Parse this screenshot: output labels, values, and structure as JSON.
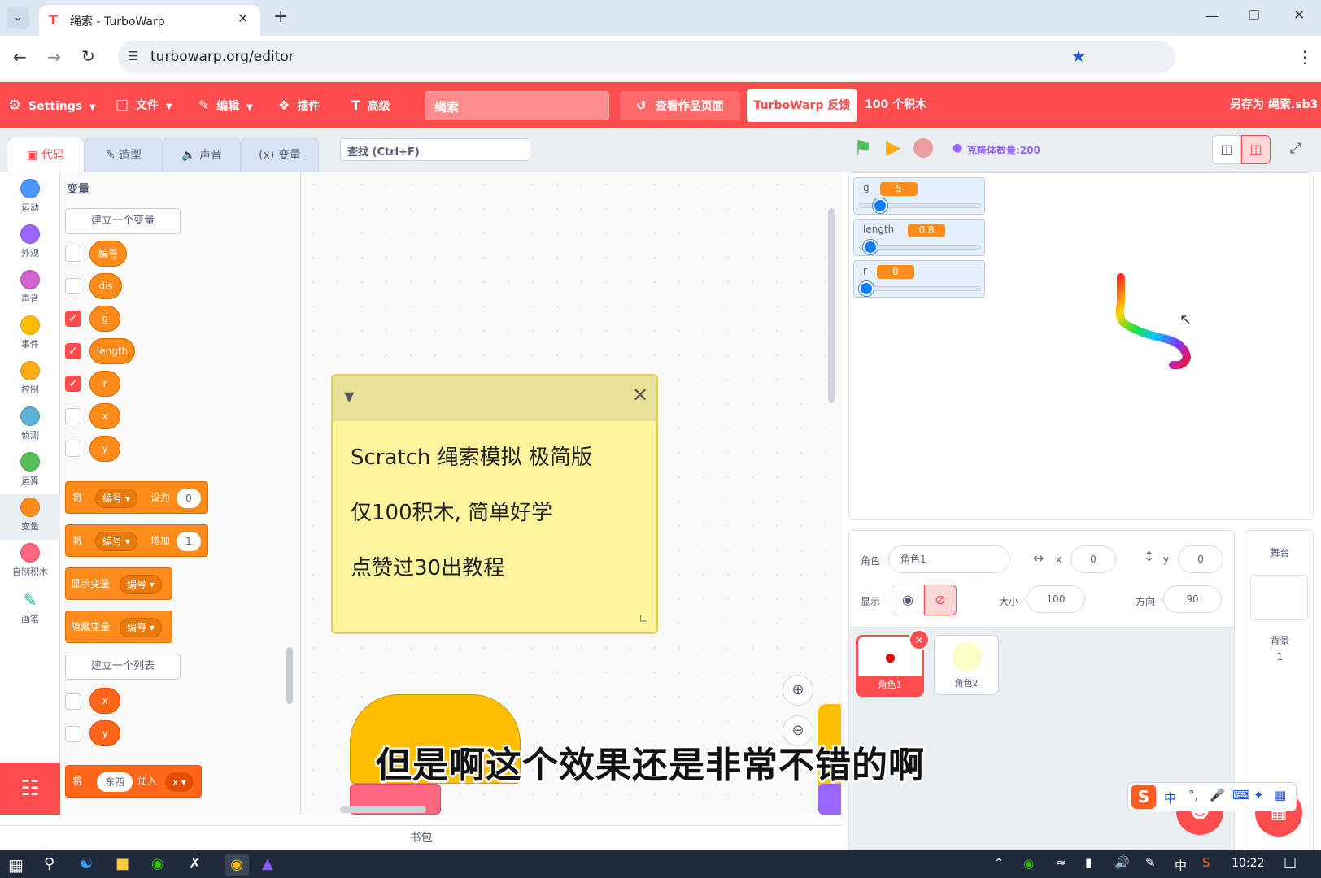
{
  "browser": {
    "tab_title": "绳索 - TurboWarp",
    "url": "turbowarp.org/editor"
  },
  "menu": {
    "settings": "Settings",
    "file": "文件",
    "edit": "编辑",
    "addons": "插件",
    "advanced": "高级",
    "project_title": "绳索",
    "see_project": "查看作品页面",
    "feedback": "TurboWarp 反馈",
    "block_count": "100 个积木",
    "save_as": "另存为 绳索.sb3"
  },
  "editor_tabs": {
    "code": "代码",
    "costumes": "造型",
    "sounds": "声音",
    "variables": "变量"
  },
  "search": {
    "placeholder": "查找 (Ctrl+F)"
  },
  "categories": [
    {
      "label": "运动",
      "color": "#4c97ff"
    },
    {
      "label": "外观",
      "color": "#9966ff"
    },
    {
      "label": "声音",
      "color": "#cf63cf"
    },
    {
      "label": "事件",
      "color": "#ffbf00"
    },
    {
      "label": "控制",
      "color": "#ffab19"
    },
    {
      "label": "侦测",
      "color": "#5cb1d6"
    },
    {
      "label": "运算",
      "color": "#59c059"
    },
    {
      "label": "变量",
      "color": "#ff8c1a"
    },
    {
      "label": "自制积木",
      "color": "#ff6680"
    },
    {
      "label": "画笔",
      "color": "#0fbd8c"
    }
  ],
  "palette": {
    "heading": "变量",
    "make_variable": "建立一个变量",
    "variables": [
      {
        "name": "编号",
        "checked": false
      },
      {
        "name": "dis",
        "checked": false
      },
      {
        "name": "g",
        "checked": true
      },
      {
        "name": "length",
        "checked": true
      },
      {
        "name": "r",
        "checked": true
      },
      {
        "name": "x",
        "checked": false
      },
      {
        "name": "y",
        "checked": false
      }
    ],
    "set_block": {
      "lead": "将",
      "var": "编号",
      "op": "设为",
      "value": "0"
    },
    "change_block": {
      "lead": "将",
      "var": "编号",
      "op": "增加",
      "value": "1"
    },
    "show_block": {
      "op": "显示变量",
      "var": "编号"
    },
    "hide_block": {
      "op": "隐藏变量",
      "var": "编号"
    },
    "make_list": "建立一个列表",
    "lists": [
      {
        "name": "x"
      },
      {
        "name": "y"
      }
    ],
    "add_block": {
      "lead": "将",
      "item": "东西",
      "op": "加入",
      "list": "x"
    }
  },
  "note": {
    "lines": [
      "Scratch 绳索模拟 极简版",
      "仅100积木, 简单好学",
      "点赞过30出教程"
    ]
  },
  "stage_header": {
    "clone_count": "克隆体数量:200"
  },
  "monitors": [
    {
      "name": "g",
      "value": "5",
      "slider_fraction": 0.13
    },
    {
      "name": "length",
      "value": "0.8",
      "slider_fraction": 0.04
    },
    {
      "name": "r",
      "value": "0",
      "slider_fraction": 0.0
    }
  ],
  "sprite_info": {
    "sprite_label": "角色",
    "sprite_name": "角色1",
    "x_label": "x",
    "x": "0",
    "y_label": "y",
    "y": "0",
    "show_label": "显示",
    "size_label": "大小",
    "size": "100",
    "direction_label": "方向",
    "direction": "90"
  },
  "sprites": [
    {
      "name": "角色1",
      "selected": true
    },
    {
      "name": "角色2",
      "selected": false
    }
  ],
  "stage_pane": {
    "title": "舞台",
    "backdrops_label": "背景",
    "backdrops_count": "1"
  },
  "backpack": "书包",
  "subtitle": "但是啊这个效果还是非常不错的啊",
  "taskbar": {
    "clock": "10:22",
    "ime": "中"
  },
  "colors": {
    "accent": "#ff4c4c",
    "variables": "#ff8c1a",
    "monitor_knob": "#0f7bff"
  }
}
